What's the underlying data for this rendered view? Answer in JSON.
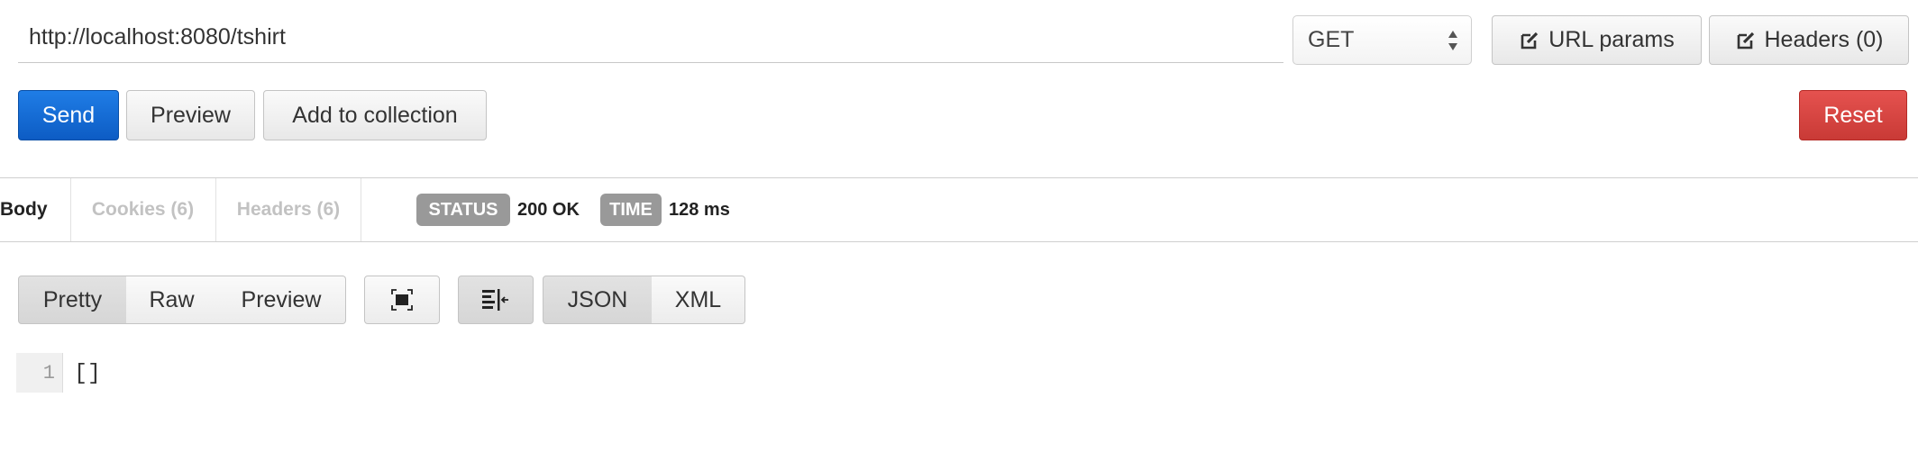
{
  "request": {
    "url": "http://localhost:8080/tshirt",
    "method": "GET",
    "url_params_label": "URL params",
    "headers_label": "Headers (0)"
  },
  "actions": {
    "send_label": "Send",
    "preview_label": "Preview",
    "add_to_collection_label": "Add to collection",
    "reset_label": "Reset"
  },
  "response": {
    "tabs": [
      {
        "label": "Body",
        "active": true
      },
      {
        "label": "Cookies (6)",
        "active": false
      },
      {
        "label": "Headers (6)",
        "active": false
      }
    ],
    "status_label": "STATUS",
    "status_value": "200 OK",
    "time_label": "TIME",
    "time_value": "128 ms",
    "view_modes": [
      "Pretty",
      "Raw",
      "Preview"
    ],
    "active_view_mode": "Pretty",
    "formats": [
      "JSON",
      "XML"
    ],
    "active_format": "JSON",
    "icons": [
      "fullscreen-icon",
      "wrap-lines-icon",
      "edit-icon"
    ],
    "code_lines": [
      {
        "number": "1",
        "text": "[]"
      }
    ]
  },
  "colors": {
    "send": "#0d5cc4",
    "reset": "#c93a36",
    "pill": "#999999"
  }
}
